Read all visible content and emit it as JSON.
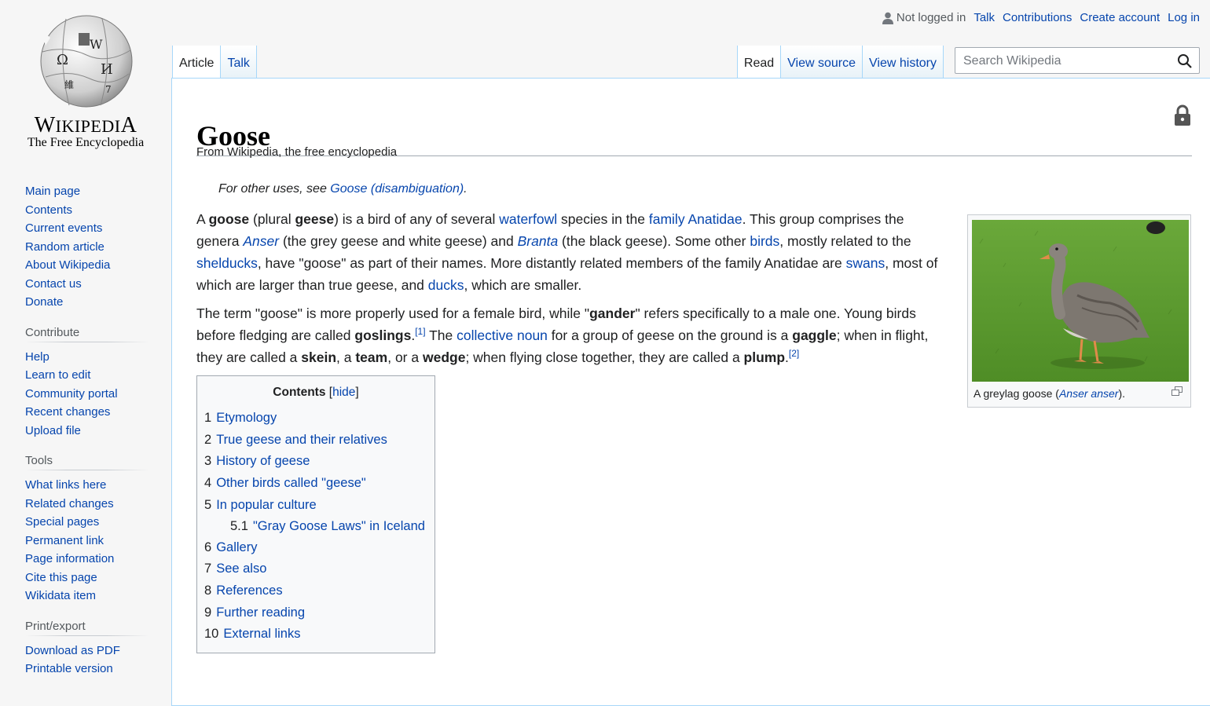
{
  "logo": {
    "wordmark_big1": "W",
    "wordmark_small": "IKIPEDI",
    "wordmark_big2": "A",
    "tagline": "The Free Encyclopedia"
  },
  "sidebar": {
    "navigation": [
      "Main page",
      "Contents",
      "Current events",
      "Random article",
      "About Wikipedia",
      "Contact us",
      "Donate"
    ],
    "contribute_title": "Contribute",
    "contribute": [
      "Help",
      "Learn to edit",
      "Community portal",
      "Recent changes",
      "Upload file"
    ],
    "tools_title": "Tools",
    "tools": [
      "What links here",
      "Related changes",
      "Special pages",
      "Permanent link",
      "Page information",
      "Cite this page",
      "Wikidata item"
    ],
    "print_title": "Print/export",
    "print": [
      "Download as PDF",
      "Printable version"
    ]
  },
  "personal": {
    "status": "Not logged in",
    "talk": "Talk",
    "contributions": "Contributions",
    "create": "Create account",
    "login": "Log in"
  },
  "tabs": {
    "article": "Article",
    "talk": "Talk",
    "read": "Read",
    "view_source": "View source",
    "view_history": "View history"
  },
  "search": {
    "placeholder": "Search Wikipedia"
  },
  "article": {
    "title": "Goose",
    "from": "From Wikipedia, the free encyclopedia",
    "hatnote_prefix": "For other uses, see ",
    "hatnote_link": "Goose (disambiguation)",
    "hatnote_suffix": "."
  },
  "p1": {
    "t1": "A ",
    "b1": "goose",
    "t2": " (plural ",
    "b2": "geese",
    "t3": ") is a bird of any of several ",
    "l1": "waterfowl",
    "t4": " species in the ",
    "l2": "family Anatidae",
    "t5": ". This group comprises the genera ",
    "l3": "Anser",
    "t6": " (the grey geese and white geese) and ",
    "l4": "Branta",
    "t7": " (the black geese). Some other ",
    "l5": "birds",
    "t8": ", mostly related to the ",
    "l6": "shelducks",
    "t9": ", have \"goose\" as part of their names. More distantly related members of the family Anatidae are ",
    "l7": "swans",
    "t10": ", most of which are larger than true geese, and ",
    "l8": "ducks",
    "t11": ", which are smaller."
  },
  "p2": {
    "t1": "The term \"goose\" is more properly used for a female bird, while \"",
    "b1": "gander",
    "t2": "\" refers specifically to a male one. Young birds before fledging are called ",
    "b2": "goslings",
    "t3": ".",
    "r1": "[1]",
    "t4": " The ",
    "l1": "collective noun",
    "t5": " for a group of geese on the ground is a ",
    "b3": "gaggle",
    "t6": "; when in flight, they are called a ",
    "b4": "skein",
    "t7": ", a ",
    "b5": "team",
    "t8": ", or a ",
    "b6": "wedge",
    "t9": "; when flying close together, they are called a ",
    "b7": "plump",
    "t10": ".",
    "r2": "[2]"
  },
  "thumb": {
    "cap_prefix": "A greylag goose (",
    "cap_link": "Anser anser",
    "cap_suffix": ")."
  },
  "toc": {
    "title": "Contents",
    "hide": "hide",
    "lb": "[",
    "rb": "]",
    "items": [
      {
        "num": "1",
        "label": "Etymology"
      },
      {
        "num": "2",
        "label": "True geese and their relatives"
      },
      {
        "num": "3",
        "label": "History of geese"
      },
      {
        "num": "4",
        "label": "Other birds called \"geese\""
      },
      {
        "num": "5",
        "label": "In popular culture"
      },
      {
        "num": "5.1",
        "label": "\"Gray Goose Laws\" in Iceland"
      },
      {
        "num": "6",
        "label": "Gallery"
      },
      {
        "num": "7",
        "label": "See also"
      },
      {
        "num": "8",
        "label": "References"
      },
      {
        "num": "9",
        "label": "Further reading"
      },
      {
        "num": "10",
        "label": "External links"
      }
    ]
  },
  "colors": {
    "link": "#0645ad",
    "tab_border": "#a7d7f9",
    "text": "#202122",
    "grass": "#5a9a2e"
  }
}
